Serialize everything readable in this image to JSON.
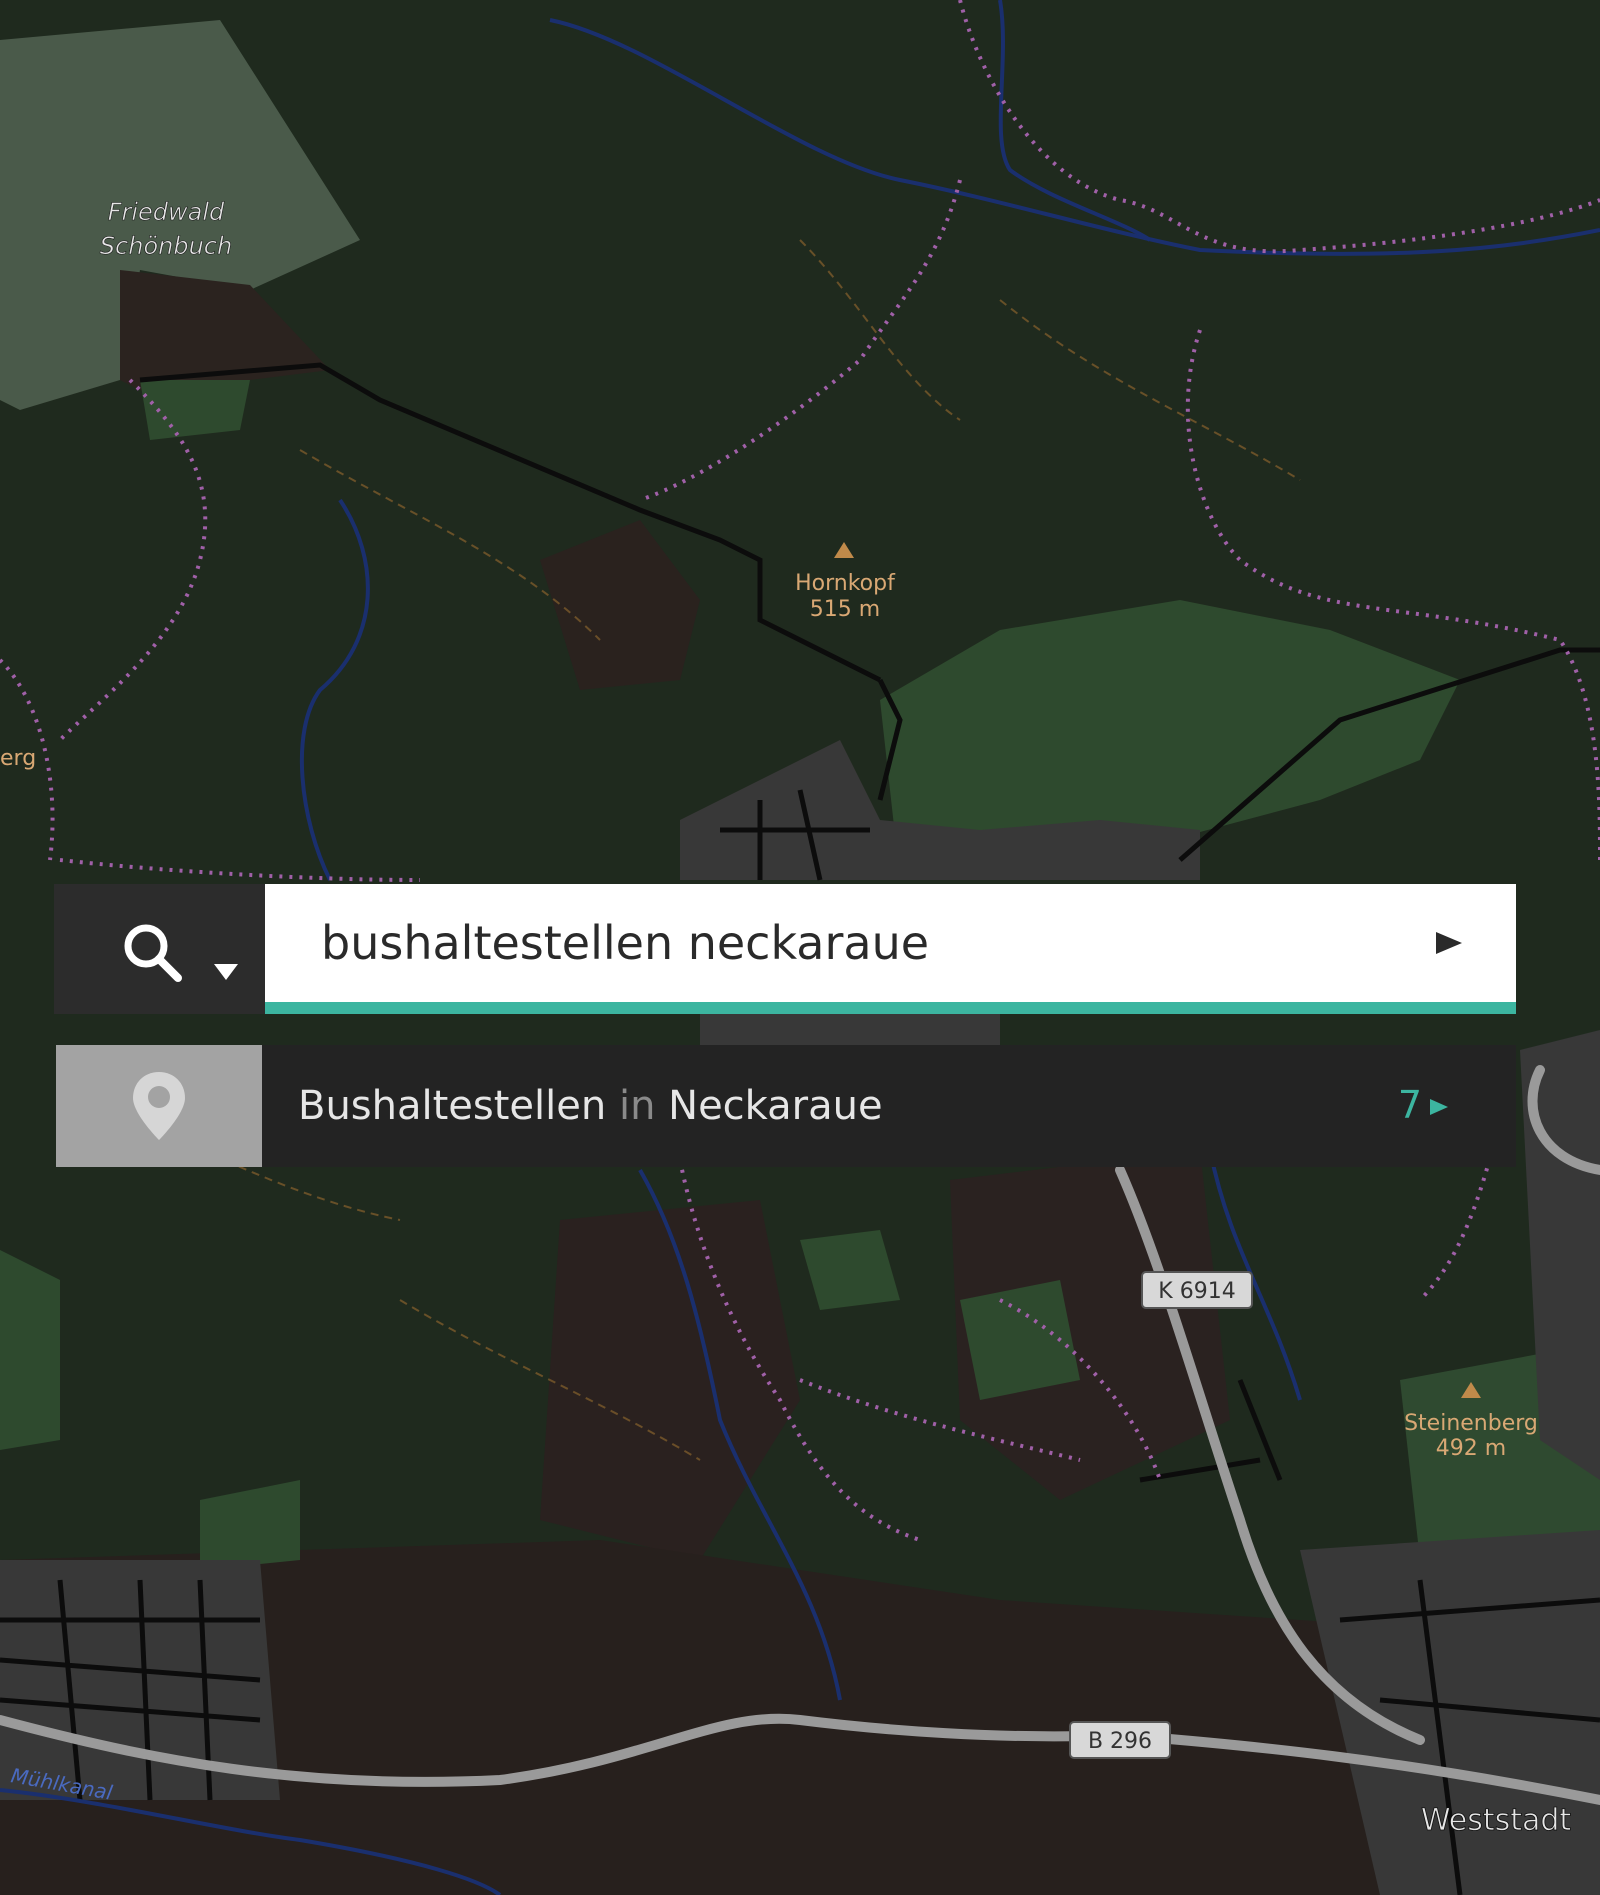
{
  "map": {
    "places": [
      {
        "name": "Friedwald",
        "kind": "forest-name-line1"
      },
      {
        "name": "Schönbuch",
        "kind": "forest-name-line2"
      },
      {
        "name": "Hornkopf",
        "kind": "peak-name"
      },
      {
        "name": "515 m",
        "kind": "peak-elevation"
      },
      {
        "name": "Steinenberg",
        "kind": "peak-name"
      },
      {
        "name": "492 m",
        "kind": "peak-elevation"
      },
      {
        "name": "Weststadt",
        "kind": "district"
      },
      {
        "name": "Mühlkanal",
        "kind": "waterway"
      },
      {
        "name": "erg",
        "kind": "cut-off-label"
      }
    ],
    "road_shields": [
      "K 6914",
      "B 296"
    ],
    "colors": {
      "forest": "#1f2a1e",
      "meadow": "#2d4a2c",
      "farmland": "#2a211f",
      "urban": "#3a3a3a",
      "water": "#1a2f6e",
      "trail": "#a060a8",
      "road_main": "#9a9a9a",
      "accent": "#3cb5a0"
    }
  },
  "search": {
    "mode_icons": [
      "search-icon",
      "chevron-down-icon"
    ],
    "query": "bushaltestellen neckaraue",
    "submit_icon": "play-arrow-icon"
  },
  "suggestion": {
    "icon": "map-pin-icon",
    "term": "Bushaltestellen",
    "connector": "in",
    "location": "Neckaraue",
    "count": "7"
  }
}
